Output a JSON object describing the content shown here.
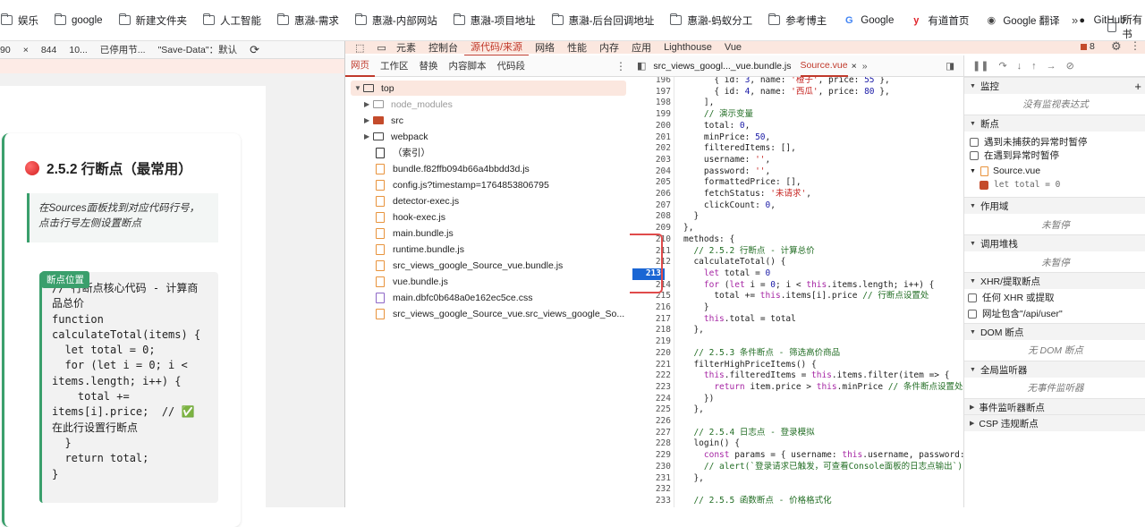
{
  "bookmarks": {
    "items": [
      {
        "label": "娱乐",
        "icon": "folder-icon"
      },
      {
        "label": "google",
        "icon": "folder-icon"
      },
      {
        "label": "新建文件夹",
        "icon": "folder-icon"
      },
      {
        "label": "人工智能",
        "icon": "folder-icon"
      },
      {
        "label": "惠瀜-需求",
        "icon": "folder-icon"
      },
      {
        "label": "惠瀜-内部网站",
        "icon": "folder-icon"
      },
      {
        "label": "惠瀜-项目地址",
        "icon": "folder-icon"
      },
      {
        "label": "惠瀜-后台回调地址",
        "icon": "folder-icon"
      },
      {
        "label": "惠瀜-蚂蚁分工",
        "icon": "folder-icon"
      },
      {
        "label": "参考博主",
        "icon": "folder-icon"
      },
      {
        "label": "Google",
        "icon": "google-icon"
      },
      {
        "label": "有道首页",
        "icon": "youdao-icon"
      },
      {
        "label": "Google 翻译",
        "icon": "google-translate-icon"
      },
      {
        "label": "GitHub",
        "icon": "github-icon"
      }
    ],
    "more": "»",
    "last_label": "所有书"
  },
  "page": {
    "strip": {
      "zoom": "90",
      "close": "×",
      "width": "844",
      "throttle": "10...",
      "disabled": "已停用节...",
      "save_data": "\"Save-Data\"：默认"
    },
    "section_title": "2.5.2 行断点（最常用）",
    "tip": "在Sources面板找到对应代码行号，点击行号左侧设置断点",
    "code_badge": "断点位置",
    "code_lines": [
      "// 行断点核心代码 - 计算商",
      "品总价",
      "function",
      "calculateTotal(items) {",
      "  let total = 0;",
      "  for (let i = 0; i <",
      "items.length; i++) {",
      "    total +=",
      "items[i].price;  // ✅",
      "在此行设置行断点",
      "  }",
      "  return total;",
      "}"
    ]
  },
  "devtools": {
    "tabs": [
      "元素",
      "控制台",
      "源代码/来源",
      "网络",
      "性能",
      "内存",
      "应用",
      "Lighthouse",
      "Vue"
    ],
    "active_tab": "源代码/来源",
    "issues_count": "8",
    "sub_tabs": [
      "网页",
      "工作区",
      "替换",
      "内容脚本",
      "代码段"
    ],
    "tree": [
      {
        "label": "top",
        "kind": "root"
      },
      {
        "label": "node_modules",
        "kind": "folder-dim"
      },
      {
        "label": "src",
        "kind": "folder-src"
      },
      {
        "label": "webpack",
        "kind": "folder"
      },
      {
        "label": "（索引）",
        "kind": "file"
      },
      {
        "label": "bundle.f82ffb094b66a4bbdd3d.js",
        "kind": "js"
      },
      {
        "label": "config.js?timestamp=1764853806795",
        "kind": "js"
      },
      {
        "label": "detector-exec.js",
        "kind": "js"
      },
      {
        "label": "hook-exec.js",
        "kind": "js"
      },
      {
        "label": "main.bundle.js",
        "kind": "js"
      },
      {
        "label": "runtime.bundle.js",
        "kind": "js"
      },
      {
        "label": "src_views_google_Source_vue.bundle.js",
        "kind": "js"
      },
      {
        "label": "vue.bundle.js",
        "kind": "js"
      },
      {
        "label": "main.dbfc0b648a0e162ec5ce.css",
        "kind": "css"
      },
      {
        "label": "src_views_google_Source_vue.src_views_google_So...",
        "kind": "js"
      }
    ],
    "editor_tabs": {
      "first": "src_views_googl..._vue.bundle.js",
      "second": "Source.vue",
      "close": "×",
      "more": "»"
    },
    "breakpoint_line": "213",
    "code": [
      {
        "n": "196",
        "t": "      { id: 3, name: '橙子', price: 55 },"
      },
      {
        "n": "197",
        "t": "      { id: 4, name: '西瓜', price: 80 },"
      },
      {
        "n": "198",
        "t": "    ],"
      },
      {
        "n": "199",
        "t": "    // 演示变量"
      },
      {
        "n": "200",
        "t": "    total: 0,"
      },
      {
        "n": "201",
        "t": "    minPrice: 50,"
      },
      {
        "n": "202",
        "t": "    filteredItems: [],"
      },
      {
        "n": "203",
        "t": "    username: '',"
      },
      {
        "n": "204",
        "t": "    password: '',"
      },
      {
        "n": "205",
        "t": "    formattedPrice: [],"
      },
      {
        "n": "206",
        "t": "    fetchStatus: '未请求',"
      },
      {
        "n": "207",
        "t": "    clickCount: 0,"
      },
      {
        "n": "208",
        "t": "  }"
      },
      {
        "n": "209",
        "t": "},"
      },
      {
        "n": "210",
        "t": "methods: {"
      },
      {
        "n": "211",
        "t": "  // 2.5.2 行断点 - 计算总价"
      },
      {
        "n": "212",
        "t": "  calculateTotal() {"
      },
      {
        "n": "213",
        "t": "    let total = 0"
      },
      {
        "n": "214",
        "t": "    for (let i = 0; i < this.items.length; i++) {"
      },
      {
        "n": "215",
        "t": "      total += this.items[i].price // 行断点设置处"
      },
      {
        "n": "216",
        "t": "    }"
      },
      {
        "n": "217",
        "t": "    this.total = total"
      },
      {
        "n": "218",
        "t": "  },"
      },
      {
        "n": "219",
        "t": ""
      },
      {
        "n": "220",
        "t": "  // 2.5.3 条件断点 - 筛选高价商品"
      },
      {
        "n": "221",
        "t": "  filterHighPriceItems() {"
      },
      {
        "n": "222",
        "t": "    this.filteredItems = this.items.filter(item => {"
      },
      {
        "n": "223",
        "t": "      return item.price > this.minPrice // 条件断点设置处"
      },
      {
        "n": "224",
        "t": "    })"
      },
      {
        "n": "225",
        "t": "  },"
      },
      {
        "n": "226",
        "t": ""
      },
      {
        "n": "227",
        "t": "  // 2.5.4 日志点 - 登录模拟"
      },
      {
        "n": "228",
        "t": "  login() {"
      },
      {
        "n": "229",
        "t": "    const params = { username: this.username, password: th"
      },
      {
        "n": "230",
        "t": "    // alert(`登录请求已触发，可查看Console面板的日志点输出`)"
      },
      {
        "n": "231",
        "t": "  },"
      },
      {
        "n": "232",
        "t": ""
      },
      {
        "n": "233",
        "t": "  // 2.5.5 函数断点 - 价格格式化"
      }
    ],
    "right_pane": {
      "watch": {
        "title": "监控",
        "empty": "没有监视表达式"
      },
      "breakpoints": {
        "title": "断点",
        "pause_uncaught": "遇到未捕获的异常时暂停",
        "pause_caught": "在遇到异常时暂停",
        "file": "Source.vue",
        "bp_code": "let total = 0"
      },
      "scope": {
        "title": "作用域",
        "empty": "未暂停"
      },
      "callstack": {
        "title": "调用堆栈",
        "empty": "未暂停"
      },
      "xhr": {
        "title": "XHR/提取断点",
        "any": "任何 XHR 或提取",
        "url": "网址包含\"/api/user\""
      },
      "dom": {
        "title": "DOM 断点",
        "empty": "无 DOM 断点"
      },
      "global": {
        "title": "全局监听器",
        "empty": "无事件监听器"
      },
      "event": {
        "title": "事件监听器断点"
      },
      "csp": {
        "title": "CSP 违规断点"
      }
    }
  }
}
